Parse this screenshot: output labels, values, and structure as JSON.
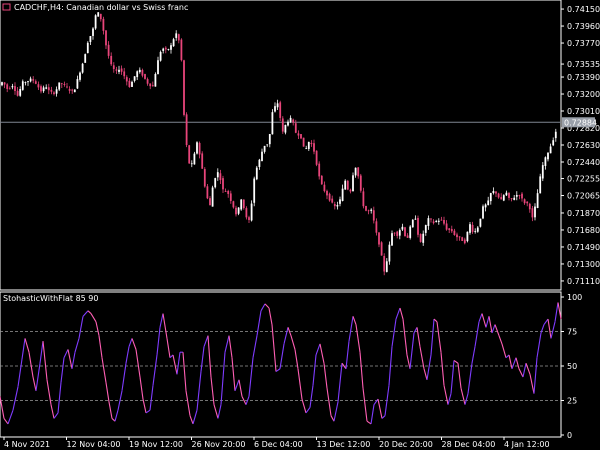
{
  "header": {
    "symbol_line": "CADCHF,H4:  Canadian dollar vs Swiss franc"
  },
  "colors": {
    "background": "#000000",
    "axis": "#ffffff",
    "candle_up": "#ffffff",
    "candle_down": "#e8457a",
    "current_price_line": "#7f8591",
    "current_price_box": "#9aa0aa",
    "oscillator_up": "#7f3cff",
    "oscillator_down": "#ff5fb4",
    "level_lines": "#9a9a9a"
  },
  "chart_data": [
    {
      "type": "candlestick",
      "title": "CADCHF,H4:  Canadian dollar vs Swiss franc",
      "y_ticks": [
        "0.74150",
        "0.73960",
        "0.73770",
        "0.73535",
        "0.73390",
        "0.73200",
        "0.73010",
        "0.72820",
        "0.72630",
        "0.72440",
        "0.72255",
        "0.72065",
        "0.71870",
        "0.71680",
        "0.71490",
        "0.71300",
        "0.71110"
      ],
      "ylim": [
        0.7102,
        0.7424
      ],
      "current_price": "0.72884",
      "path_points": [
        [
          0,
          0.7329
        ],
        [
          4,
          0.7334
        ],
        [
          9,
          0.7325
        ],
        [
          14,
          0.733
        ],
        [
          19,
          0.7318
        ],
        [
          24,
          0.7333
        ],
        [
          28,
          0.7334
        ],
        [
          33,
          0.7337
        ],
        [
          38,
          0.7331
        ],
        [
          42,
          0.7323
        ],
        [
          47,
          0.7329
        ],
        [
          51,
          0.7322
        ],
        [
          56,
          0.7321
        ],
        [
          61,
          0.7333
        ],
        [
          66,
          0.7329
        ],
        [
          70,
          0.7325
        ],
        [
          75,
          0.7322
        ],
        [
          79,
          0.7337
        ],
        [
          85,
          0.7358
        ],
        [
          89,
          0.7378
        ],
        [
          94,
          0.7391
        ],
        [
          98,
          0.7414
        ],
        [
          103,
          0.7402
        ],
        [
          107,
          0.7376
        ],
        [
          112,
          0.7353
        ],
        [
          117,
          0.7344
        ],
        [
          121,
          0.7349
        ],
        [
          126,
          0.7339
        ],
        [
          131,
          0.7328
        ],
        [
          136,
          0.734
        ],
        [
          140,
          0.7348
        ],
        [
          145,
          0.7339
        ],
        [
          149,
          0.7332
        ],
        [
          154,
          0.7328
        ],
        [
          159,
          0.7356
        ],
        [
          163,
          0.7372
        ],
        [
          168,
          0.7368
        ],
        [
          173,
          0.7375
        ],
        [
          177,
          0.7389
        ],
        [
          182,
          0.7374
        ],
        [
          186,
          0.728
        ],
        [
          190,
          0.7243
        ],
        [
          194,
          0.7241
        ],
        [
          198,
          0.7268
        ],
        [
          202,
          0.7247
        ],
        [
          207,
          0.7211
        ],
        [
          211,
          0.7193
        ],
        [
          215,
          0.7224
        ],
        [
          220,
          0.7234
        ],
        [
          224,
          0.7213
        ],
        [
          229,
          0.721
        ],
        [
          234,
          0.7196
        ],
        [
          238,
          0.7184
        ],
        [
          243,
          0.7205
        ],
        [
          247,
          0.7182
        ],
        [
          251,
          0.7178
        ],
        [
          256,
          0.7231
        ],
        [
          261,
          0.7247
        ],
        [
          265,
          0.7262
        ],
        [
          270,
          0.7265
        ],
        [
          274,
          0.7302
        ],
        [
          279,
          0.731
        ],
        [
          284,
          0.7277
        ],
        [
          288,
          0.7289
        ],
        [
          293,
          0.7293
        ],
        [
          297,
          0.7277
        ],
        [
          302,
          0.7273
        ],
        [
          306,
          0.7255
        ],
        [
          311,
          0.7269
        ],
        [
          316,
          0.7254
        ],
        [
          320,
          0.7229
        ],
        [
          324,
          0.7215
        ],
        [
          329,
          0.7206
        ],
        [
          333,
          0.7198
        ],
        [
          337,
          0.7193
        ],
        [
          342,
          0.7203
        ],
        [
          346,
          0.7225
        ],
        [
          351,
          0.7207
        ],
        [
          356,
          0.7242
        ],
        [
          360,
          0.7226
        ],
        [
          364,
          0.7197
        ],
        [
          368,
          0.7188
        ],
        [
          373,
          0.719
        ],
        [
          377,
          0.7167
        ],
        [
          381,
          0.715
        ],
        [
          386,
          0.7119
        ],
        [
          390,
          0.7147
        ],
        [
          394,
          0.7168
        ],
        [
          399,
          0.7162
        ],
        [
          403,
          0.7174
        ],
        [
          408,
          0.7156
        ],
        [
          413,
          0.7177
        ],
        [
          417,
          0.7182
        ],
        [
          421,
          0.715
        ],
        [
          426,
          0.717
        ],
        [
          430,
          0.7181
        ],
        [
          435,
          0.7176
        ],
        [
          439,
          0.7179
        ],
        [
          444,
          0.7178
        ],
        [
          448,
          0.7169
        ],
        [
          453,
          0.7167
        ],
        [
          457,
          0.7161
        ],
        [
          462,
          0.7158
        ],
        [
          466,
          0.7154
        ],
        [
          471,
          0.7175
        ],
        [
          475,
          0.7164
        ],
        [
          480,
          0.7173
        ],
        [
          484,
          0.7193
        ],
        [
          489,
          0.7198
        ],
        [
          493,
          0.7212
        ],
        [
          498,
          0.7209
        ],
        [
          502,
          0.72
        ],
        [
          507,
          0.7211
        ],
        [
          511,
          0.7201
        ],
        [
          516,
          0.7205
        ],
        [
          520,
          0.7209
        ],
        [
          525,
          0.7199
        ],
        [
          530,
          0.7197
        ],
        [
          534,
          0.718
        ],
        [
          538,
          0.7203
        ],
        [
          543,
          0.7237
        ],
        [
          547,
          0.7249
        ],
        [
          552,
          0.7262
        ],
        [
          556,
          0.7274
        ],
        [
          560,
          0.7289
        ]
      ]
    },
    {
      "type": "line",
      "title": "StohasticWithFlat 85 90",
      "y_ticks": [
        "100",
        "75",
        "50",
        "25",
        "0"
      ],
      "ylim": [
        0,
        100
      ],
      "levels": [
        75,
        50,
        25
      ],
      "points": [
        [
          0,
          28
        ],
        [
          4,
          12
        ],
        [
          8,
          8
        ],
        [
          13,
          18
        ],
        [
          18,
          35
        ],
        [
          22,
          55
        ],
        [
          25,
          70
        ],
        [
          29,
          60
        ],
        [
          33,
          42
        ],
        [
          36,
          32
        ],
        [
          40,
          52
        ],
        [
          43,
          68
        ],
        [
          47,
          40
        ],
        [
          51,
          22
        ],
        [
          54,
          12
        ],
        [
          58,
          16
        ],
        [
          61,
          38
        ],
        [
          64,
          56
        ],
        [
          68,
          62
        ],
        [
          72,
          48
        ],
        [
          75,
          60
        ],
        [
          79,
          70
        ],
        [
          83,
          86
        ],
        [
          88,
          90
        ],
        [
          91,
          88
        ],
        [
          96,
          82
        ],
        [
          99,
          72
        ],
        [
          102,
          56
        ],
        [
          106,
          38
        ],
        [
          109,
          24
        ],
        [
          112,
          12
        ],
        [
          115,
          10
        ],
        [
          118,
          18
        ],
        [
          122,
          32
        ],
        [
          126,
          52
        ],
        [
          129,
          64
        ],
        [
          132,
          70
        ],
        [
          136,
          62
        ],
        [
          140,
          42
        ],
        [
          143,
          26
        ],
        [
          146,
          16
        ],
        [
          150,
          18
        ],
        [
          153,
          36
        ],
        [
          157,
          58
        ],
        [
          160,
          78
        ],
        [
          163,
          88
        ],
        [
          167,
          70
        ],
        [
          170,
          56
        ],
        [
          173,
          58
        ],
        [
          177,
          44
        ],
        [
          180,
          60
        ],
        [
          183,
          60
        ],
        [
          186,
          32
        ],
        [
          190,
          14
        ],
        [
          193,
          8
        ],
        [
          197,
          18
        ],
        [
          201,
          46
        ],
        [
          204,
          64
        ],
        [
          208,
          72
        ],
        [
          211,
          42
        ],
        [
          214,
          22
        ],
        [
          218,
          12
        ],
        [
          221,
          22
        ],
        [
          225,
          60
        ],
        [
          229,
          72
        ],
        [
          232,
          56
        ],
        [
          235,
          32
        ],
        [
          239,
          40
        ],
        [
          242,
          28
        ],
        [
          246,
          22
        ],
        [
          249,
          28
        ],
        [
          253,
          56
        ],
        [
          257,
          72
        ],
        [
          261,
          90
        ],
        [
          265,
          95
        ],
        [
          269,
          92
        ],
        [
          272,
          80
        ],
        [
          276,
          46
        ],
        [
          280,
          48
        ],
        [
          284,
          66
        ],
        [
          288,
          78
        ],
        [
          291,
          72
        ],
        [
          295,
          62
        ],
        [
          298,
          48
        ],
        [
          302,
          26
        ],
        [
          306,
          16
        ],
        [
          310,
          20
        ],
        [
          313,
          36
        ],
        [
          316,
          58
        ],
        [
          320,
          66
        ],
        [
          324,
          52
        ],
        [
          327,
          34
        ],
        [
          331,
          14
        ],
        [
          334,
          10
        ],
        [
          338,
          24
        ],
        [
          342,
          52
        ],
        [
          346,
          48
        ],
        [
          349,
          68
        ],
        [
          353,
          86
        ],
        [
          356,
          80
        ],
        [
          360,
          60
        ],
        [
          363,
          34
        ],
        [
          367,
          10
        ],
        [
          371,
          8
        ],
        [
          374,
          22
        ],
        [
          378,
          26
        ],
        [
          382,
          12
        ],
        [
          385,
          14
        ],
        [
          389,
          36
        ],
        [
          392,
          64
        ],
        [
          396,
          84
        ],
        [
          400,
          92
        ],
        [
          403,
          84
        ],
        [
          407,
          58
        ],
        [
          410,
          48
        ],
        [
          414,
          74
        ],
        [
          417,
          78
        ],
        [
          420,
          64
        ],
        [
          424,
          48
        ],
        [
          427,
          40
        ],
        [
          431,
          58
        ],
        [
          434,
          84
        ],
        [
          437,
          82
        ],
        [
          441,
          60
        ],
        [
          444,
          36
        ],
        [
          448,
          22
        ],
        [
          451,
          30
        ],
        [
          454,
          54
        ],
        [
          458,
          52
        ],
        [
          461,
          34
        ],
        [
          465,
          22
        ],
        [
          468,
          30
        ],
        [
          472,
          52
        ],
        [
          475,
          64
        ],
        [
          479,
          82
        ],
        [
          482,
          88
        ],
        [
          486,
          78
        ],
        [
          489,
          86
        ],
        [
          492,
          74
        ],
        [
          495,
          80
        ],
        [
          499,
          72
        ],
        [
          502,
          66
        ],
        [
          506,
          56
        ],
        [
          509,
          58
        ],
        [
          512,
          48
        ],
        [
          516,
          56
        ],
        [
          519,
          48
        ],
        [
          523,
          42
        ],
        [
          526,
          52
        ],
        [
          530,
          44
        ],
        [
          534,
          30
        ],
        [
          537,
          56
        ],
        [
          541,
          74
        ],
        [
          544,
          80
        ],
        [
          548,
          84
        ],
        [
          551,
          70
        ],
        [
          555,
          82
        ],
        [
          558,
          96
        ],
        [
          561,
          84
        ]
      ]
    }
  ],
  "x_axis": {
    "labels": [
      "4 Nov 2021",
      "12 Nov 04:00",
      "19 Nov 12:00",
      "26 Nov 20:00",
      "6 Dec 04:00",
      "13 Dec 12:00",
      "20 Dec 20:00",
      "28 Dec 04:00",
      "4 Jan 12:00"
    ]
  }
}
